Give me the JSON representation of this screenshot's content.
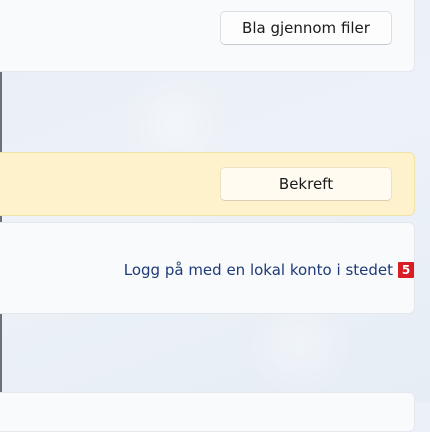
{
  "files_section": {
    "browse_button_label": "Bla gjennom filer"
  },
  "warning_section": {
    "confirm_button_label": "Bekreft"
  },
  "account_section": {
    "local_account_link": "Logg på med en lokal konto i stedet",
    "step_badge": "5"
  },
  "colors": {
    "warning_background": "#fdf2cc",
    "link": "#1f3a78",
    "badge": "#d81e24"
  }
}
